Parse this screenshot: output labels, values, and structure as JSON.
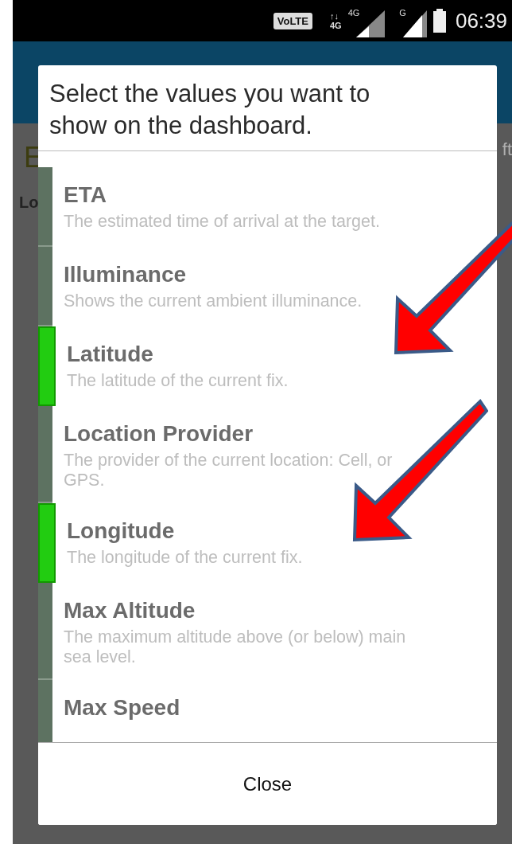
{
  "status_bar": {
    "volte": "VoLTE",
    "data_arrows": "↑↓",
    "network_badge": "4G",
    "network_type": "4G",
    "sim2_type": "G",
    "time": "06:39"
  },
  "background": {
    "heading": "E",
    "label": "Lo",
    "right_text": "ft"
  },
  "dialog": {
    "title": "Select the values you want to show on the dashboard.",
    "items": [
      {
        "title": "ETA",
        "description": "The estimated time of arrival at the target.",
        "selected": false
      },
      {
        "title": "Illuminance",
        "description": "Shows the current ambient illuminance.",
        "selected": false
      },
      {
        "title": "Latitude",
        "description": "The latitude of the current fix.",
        "selected": true
      },
      {
        "title": "Location Provider",
        "description": "The provider of the current location: Cell, or GPS.",
        "selected": false
      },
      {
        "title": "Longitude",
        "description": "The longitude of the current fix.",
        "selected": true
      },
      {
        "title": "Max Altitude",
        "description": "The maximum altitude above (or below) main sea level.",
        "selected": false
      },
      {
        "title": "Max Speed",
        "selected": false
      }
    ],
    "close_button": "Close"
  },
  "annotations": [
    {
      "kind": "arrow"
    },
    {
      "kind": "arrow"
    }
  ]
}
